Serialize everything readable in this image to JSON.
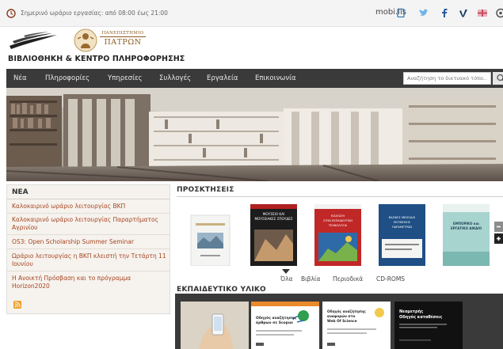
{
  "topbar": {
    "hours_text": "Σημερινό ωράριο εργασίας: από 08:00 έως 21:00",
    "mobile_label": "mobi.lis",
    "icons": [
      "clock-icon",
      "mobile-icon",
      "twitter-icon",
      "facebook-icon",
      "vimeo-icon",
      "flag-uk-icon",
      "settings-icon"
    ]
  },
  "header": {
    "university_line1": "ΠΑΝΕΠΙΣΤΗΜΙΟ",
    "university_line2": "ΠΑΤΡΩΝ",
    "site_title": "ΒΙΒΛΙΟΘΗΚΗ & ΚΕΝΤΡΟ ΠΛΗΡΟΦΟΡΗΣΗΣ"
  },
  "nav": {
    "items": [
      "Νέα",
      "Πληροφορίες",
      "Υπηρεσίες",
      "Συλλογές",
      "Εργαλεία",
      "Επικοινωνία"
    ],
    "search_placeholder": "Αναζήτηση το δικτυακό τόπο..."
  },
  "news": {
    "title": "ΝΕΑ",
    "items": [
      "Καλοκαιρινό ωράριο λειτουργίας ΒΚΠ",
      "Καλοκαιρινό ωράριο λειτουργίας Παραρτήματος Αγρινίου",
      "OS3: Open Scholarship Summer Seminar",
      "Ωράριο λειτουργίας η ΒΚΠ κλειστή την Τετάρτη 11 Ιουνίου",
      "Η Ανοικτή Πρόσβαση και το πρόγραμμα Horizon2020"
    ]
  },
  "acquisitions": {
    "title": "ΠΡΟΣΚΤΗΣΕΙΣ",
    "books": [
      {
        "cover_text": ""
      },
      {
        "cover_text": "ΜΟΥΣΕΙΟ ΚΑΙ ΜΟΥΣΕΙΑΚΕΣ ΣΠΟΥΔΕΣ"
      },
      {
        "cover_text": "ΕΙΣΑΓΩΓΗ ΣΤΗΝ ΕΚΠΑΙΔΕΥΤΙΚΗ ΤΕΧΝΟΛΟΓΙΑ"
      },
      {
        "cover_text": "ΒΑΣΙΚΕΣ ΜΕΘΟΔΟΙ ΕΚΤΙΜΗΣΗΣ ΠΑΡΑΜΕΤΡΩΝ"
      },
      {
        "cover_text": "ΕΜΠΟΡΙΚΟ και ΕΡΓΑΤΙΚΟ ΔΙΚΑΙΟ"
      }
    ]
  },
  "filters": {
    "items": [
      "Όλα",
      "Βιβλία",
      "Περιοδικά",
      "CD-ROMS"
    ]
  },
  "education": {
    "title": "ΕΚΠΑΙΔΕΥΤΙΚΟ ΥΛΙΚΟ",
    "thumbs": [
      {
        "text": ""
      },
      {
        "text": "Οδηγός αναζήτησης άρθρων σε Scopus"
      },
      {
        "text": "Οδηγός αναζήτησης αναφορών στο Web Of Science"
      },
      {
        "text": "Νεομετρής Οδηγός καταθέσεις"
      }
    ]
  },
  "colors": {
    "nav_bg": "#3a3a3a",
    "news_link": "#a64420",
    "news_bg": "#f6f3ee",
    "brand_gold": "#8a5a1e"
  }
}
